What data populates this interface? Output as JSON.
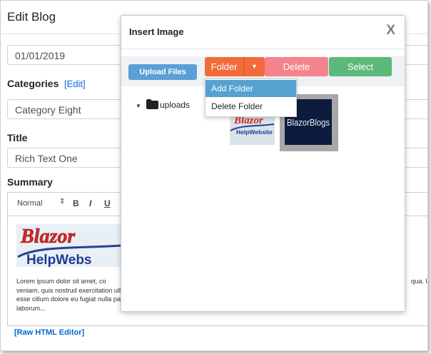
{
  "page": {
    "title": "Edit Blog",
    "date_value": "01/01/2019",
    "categories_label": "Categories",
    "categories_edit": "[Edit]",
    "category_value": "Category Eight",
    "title_label": "Title",
    "title_value": "Rich Text One",
    "summary_label": "Summary",
    "raw_html_link": "[Raw HTML Editor]"
  },
  "editor": {
    "format_select": "Normal",
    "bold": "B",
    "italic": "I",
    "underline": "U",
    "logo_text_1": "Blazor",
    "logo_text_2": "HelpWebs",
    "lorem_lines": [
      "Lorem ipsum dolor sit amet, co",
      "veniam, quis nostrud exercitation ullamco laboris nisi ut aliquip ex ea commodo consequat. Duis aute irure dolor in reprehend",
      "esse cillum dolore eu fugiat nulla pariatur. Excepteur sint occaecat cupidatat non proident, sunt in culpa qui officia deserunt m",
      "laborum..."
    ],
    "lorem_tail": "qua. U"
  },
  "modal": {
    "title": "Insert Image",
    "close": "X",
    "upload_button": "Upload Files",
    "folder_button": "Folder",
    "delete_button": "Delete",
    "select_button": "Select",
    "folder_menu": [
      "Add Folder",
      "Delete Folder"
    ],
    "tree_root": "uploads",
    "thumb1_line1": "Blazor",
    "thumb1_line2": "HelpWebsite",
    "thumb2_text": "BlazorBlogs"
  },
  "colors": {
    "orange": "#f36b3b",
    "pink": "#f4838b",
    "green": "#5cb97a",
    "blue": "#5b9fd6",
    "link": "#0366d6"
  }
}
